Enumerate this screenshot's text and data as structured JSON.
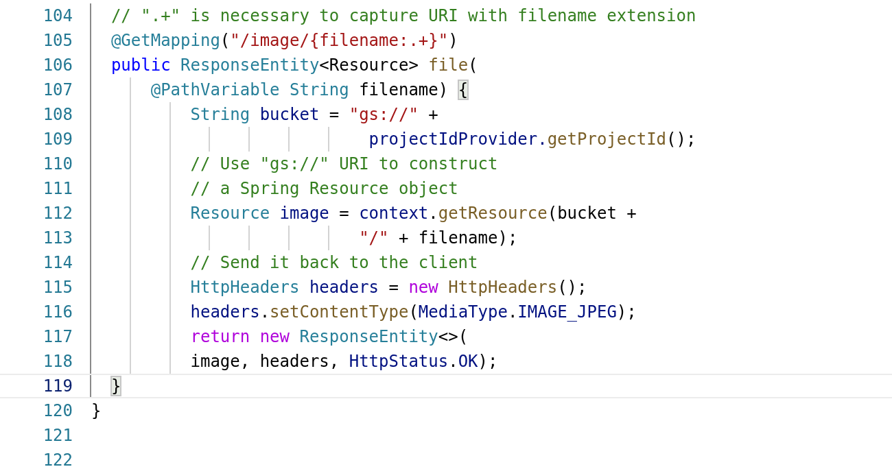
{
  "editor": {
    "lines": [
      {
        "number": "104",
        "current": false,
        "tokens": [
          {
            "text": "  // \".+\" is necessary to capture URI with filename extension",
            "kind": "comment"
          }
        ]
      },
      {
        "number": "105",
        "current": false,
        "tokens": [
          {
            "text": "  @GetMapping",
            "kind": "type"
          },
          {
            "text": "(",
            "kind": "plain"
          },
          {
            "text": "\"/image/{filename:.+}\"",
            "kind": "string"
          },
          {
            "text": ")",
            "kind": "plain"
          }
        ]
      },
      {
        "number": "106",
        "current": false,
        "tokens": [
          {
            "text": "  public ",
            "kind": "keyword"
          },
          {
            "text": "ResponseEntity",
            "kind": "type"
          },
          {
            "text": "<Resource> ",
            "kind": "plain"
          },
          {
            "text": "file",
            "kind": "method"
          },
          {
            "text": "(",
            "kind": "plain"
          }
        ]
      },
      {
        "number": "107",
        "current": false,
        "tokens": [
          {
            "text": "      @PathVariable String",
            "kind": "type"
          },
          {
            "text": " filename) ",
            "kind": "plain"
          },
          {
            "text": "{",
            "kind": "bracket-match"
          }
        ]
      },
      {
        "number": "108",
        "current": false,
        "tokens": [
          {
            "text": "          String ",
            "kind": "type"
          },
          {
            "text": "bucket",
            "kind": "variable"
          },
          {
            "text": " = ",
            "kind": "plain"
          },
          {
            "text": "\"gs://\"",
            "kind": "string"
          },
          {
            "text": " +",
            "kind": "plain"
          }
        ]
      },
      {
        "number": "109",
        "current": false,
        "tokens": [
          {
            "text": "                            projectIdProvider.",
            "kind": "variable"
          },
          {
            "text": "getProjectId",
            "kind": "method"
          },
          {
            "text": "();",
            "kind": "plain"
          }
        ]
      },
      {
        "number": "110",
        "current": false,
        "tokens": [
          {
            "text": "          // Use \"gs://\" URI to construct",
            "kind": "comment"
          }
        ]
      },
      {
        "number": "111",
        "current": false,
        "tokens": [
          {
            "text": "          // a Spring Resource object",
            "kind": "comment"
          }
        ]
      },
      {
        "number": "112",
        "current": false,
        "tokens": [
          {
            "text": "          Resource ",
            "kind": "type"
          },
          {
            "text": "image",
            "kind": "variable"
          },
          {
            "text": " = ",
            "kind": "plain"
          },
          {
            "text": "context",
            "kind": "variable"
          },
          {
            "text": ".",
            "kind": "plain"
          },
          {
            "text": "getResource",
            "kind": "method"
          },
          {
            "text": "(bucket +",
            "kind": "plain"
          }
        ]
      },
      {
        "number": "113",
        "current": false,
        "tokens": [
          {
            "text": "                           \"/\"",
            "kind": "string"
          },
          {
            "text": " + filename);",
            "kind": "plain"
          }
        ]
      },
      {
        "number": "114",
        "current": false,
        "tokens": [
          {
            "text": "          // Send it back to the client",
            "kind": "comment"
          }
        ]
      },
      {
        "number": "115",
        "current": false,
        "tokens": [
          {
            "text": "          HttpHeaders ",
            "kind": "type"
          },
          {
            "text": "headers",
            "kind": "variable"
          },
          {
            "text": " = ",
            "kind": "plain"
          },
          {
            "text": "new ",
            "kind": "control"
          },
          {
            "text": "HttpHeaders",
            "kind": "method"
          },
          {
            "text": "();",
            "kind": "plain"
          }
        ]
      },
      {
        "number": "116",
        "current": false,
        "tokens": [
          {
            "text": "          headers",
            "kind": "variable"
          },
          {
            "text": ".",
            "kind": "plain"
          },
          {
            "text": "setContentType",
            "kind": "method"
          },
          {
            "text": "(",
            "kind": "plain"
          },
          {
            "text": "MediaType",
            "kind": "variable"
          },
          {
            "text": ".",
            "kind": "plain"
          },
          {
            "text": "IMAGE_JPEG",
            "kind": "variable"
          },
          {
            "text": ");",
            "kind": "plain"
          }
        ]
      },
      {
        "number": "117",
        "current": false,
        "tokens": [
          {
            "text": "          return new ",
            "kind": "control"
          },
          {
            "text": "ResponseEntity",
            "kind": "type"
          },
          {
            "text": "<>(",
            "kind": "plain"
          }
        ]
      },
      {
        "number": "118",
        "current": false,
        "tokens": [
          {
            "text": "          image, headers, ",
            "kind": "plain"
          },
          {
            "text": "HttpStatus",
            "kind": "variable"
          },
          {
            "text": ".",
            "kind": "plain"
          },
          {
            "text": "OK",
            "kind": "variable"
          },
          {
            "text": ");",
            "kind": "plain"
          }
        ]
      },
      {
        "number": "119",
        "current": true,
        "tokens": [
          {
            "text": "  }",
            "kind": "bracket-end"
          }
        ]
      },
      {
        "number": "120",
        "current": false,
        "tokens": [
          {
            "text": "}",
            "kind": "plain"
          }
        ]
      },
      {
        "number": "121",
        "current": false
      },
      {
        "number": "122",
        "current": false
      }
    ]
  }
}
